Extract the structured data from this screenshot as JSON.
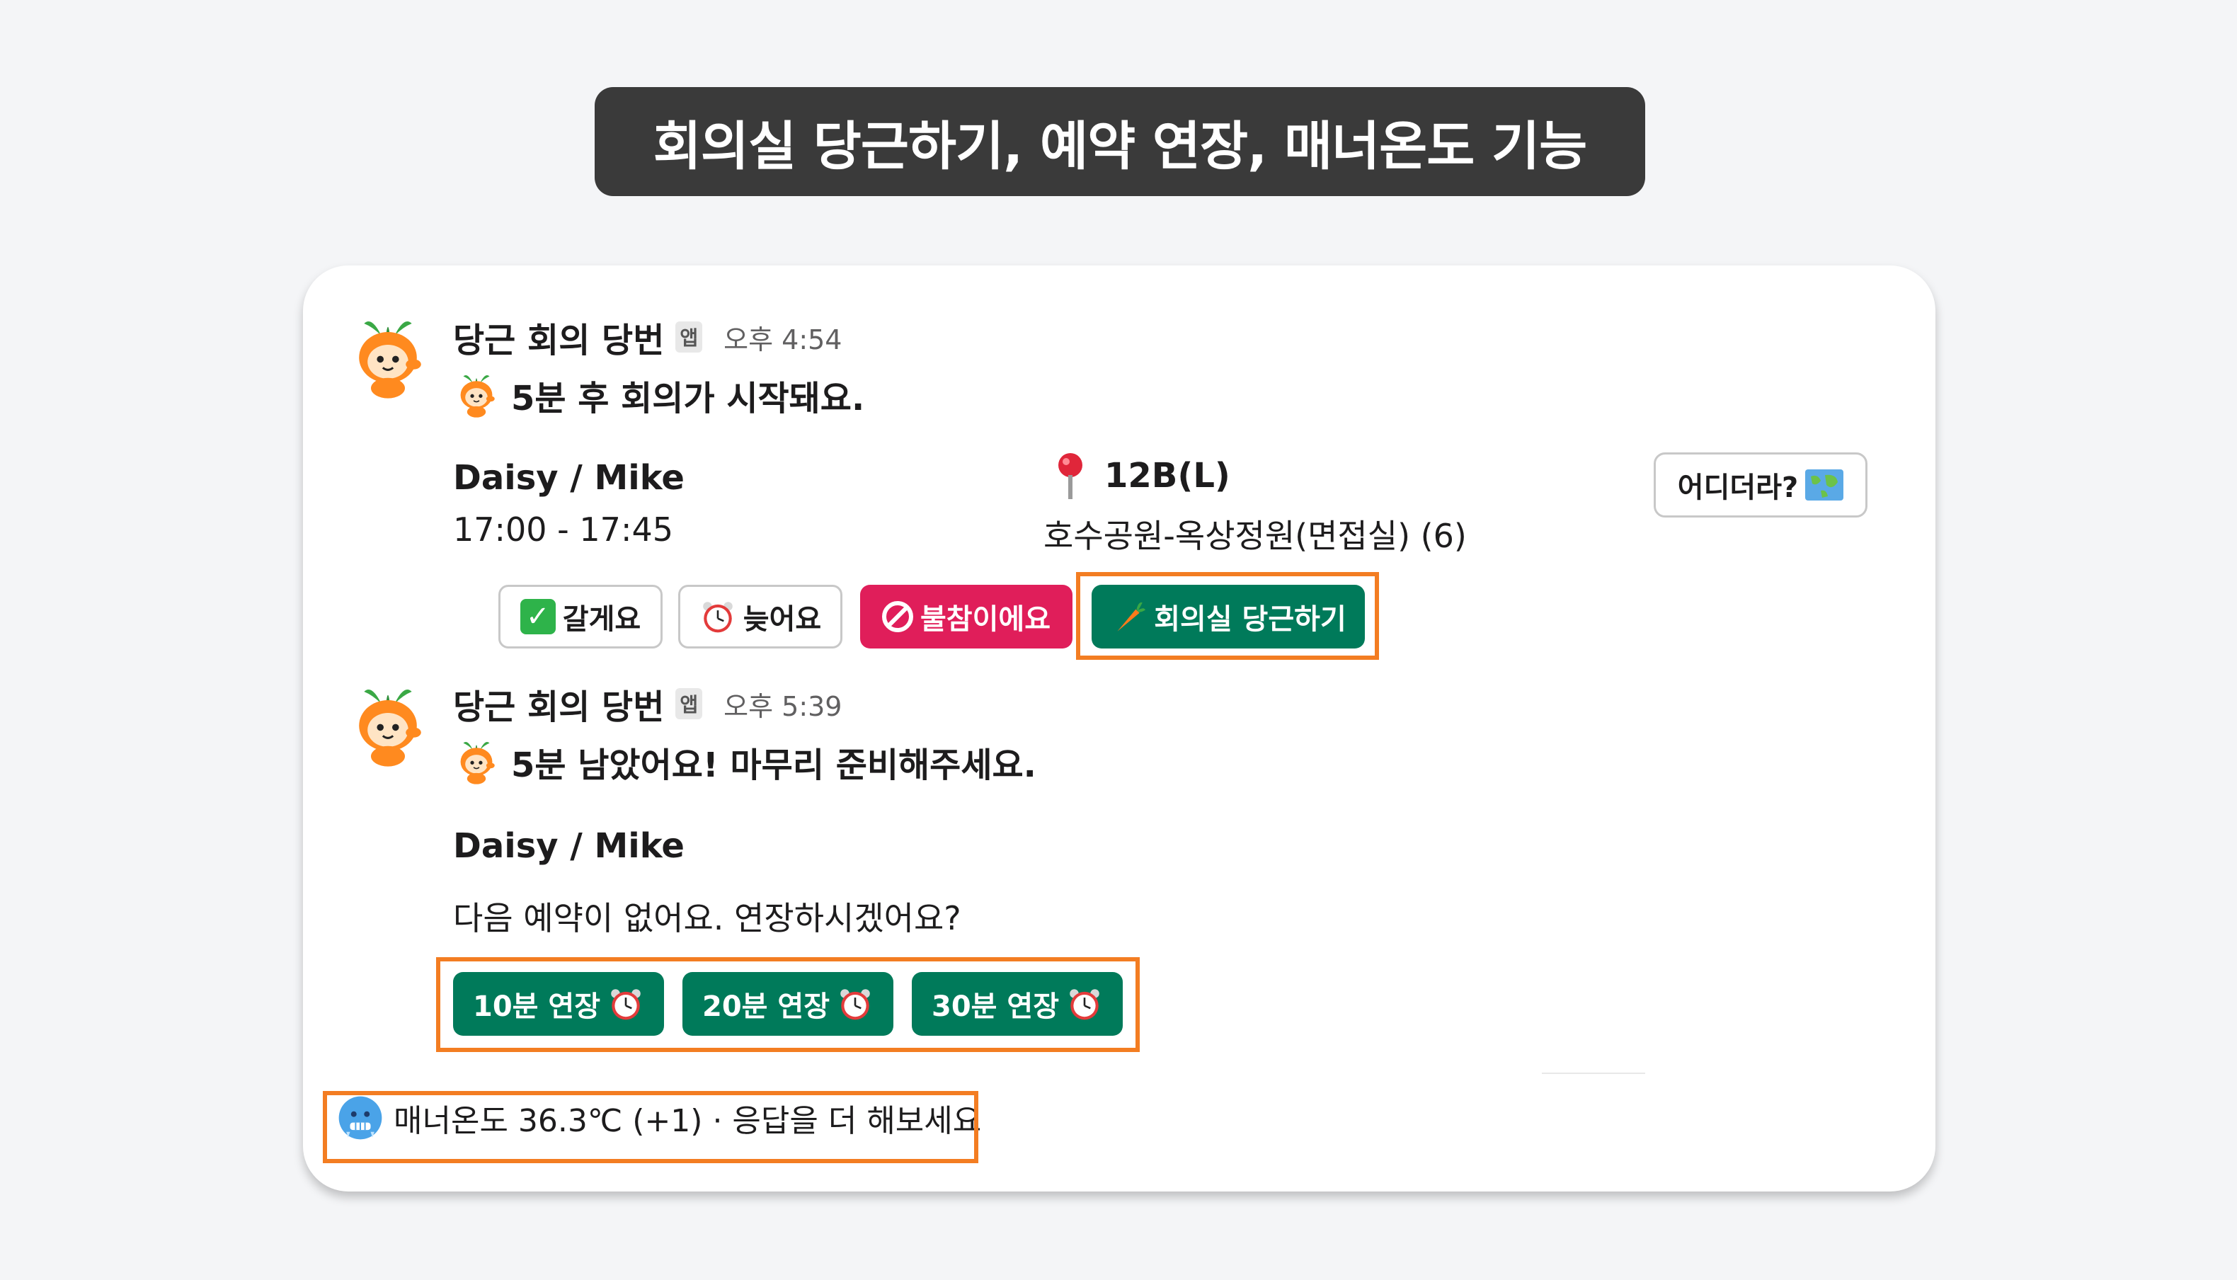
{
  "banner_title": "회의실 당근하기, 예약 연장, 매너온도 기능",
  "messages": [
    {
      "sender": "당근 회의 당번",
      "badge": "앱",
      "time": "오후 4:54",
      "text": "5분 후 회의가 시작돼요.",
      "participants": "Daisy / Mike",
      "time_range": "17:00 - 17:45",
      "room": "12B(L)",
      "location": "호수공원-옥상정원(면접실) (6)",
      "where_button": "어디더라?",
      "actions": [
        {
          "label": "갈게요",
          "icon": "check-mark-icon"
        },
        {
          "label": "늦어요",
          "icon": "alarm-clock-icon"
        },
        {
          "label": "불참이에요",
          "icon": "no-entry-icon"
        },
        {
          "label": "회의실 당근하기",
          "icon": "carrot-icon"
        }
      ]
    },
    {
      "sender": "당근 회의 당번",
      "badge": "앱",
      "time": "오후 5:39",
      "text": "5분 남았어요! 마무리 준비해주세요.",
      "participants": "Daisy / Mike",
      "prompt": "다음 예약이 없어요. 연장하시겠어요?",
      "extend_buttons": [
        {
          "label": "10분 연장",
          "icon": "alarm-clock-icon"
        },
        {
          "label": "20분 연장",
          "icon": "alarm-clock-icon"
        },
        {
          "label": "30분 연장",
          "icon": "alarm-clock-icon"
        }
      ]
    }
  ],
  "manner": {
    "text": "매너온도 36.3℃ (+1) · 응답을 더 해보세요",
    "icon": "cold-face-icon"
  },
  "colors": {
    "primary_green": "#007a5a",
    "danger_pink": "#e01e5a",
    "highlight_orange": "#f37d22",
    "banner_dark": "#3a3a3a"
  }
}
